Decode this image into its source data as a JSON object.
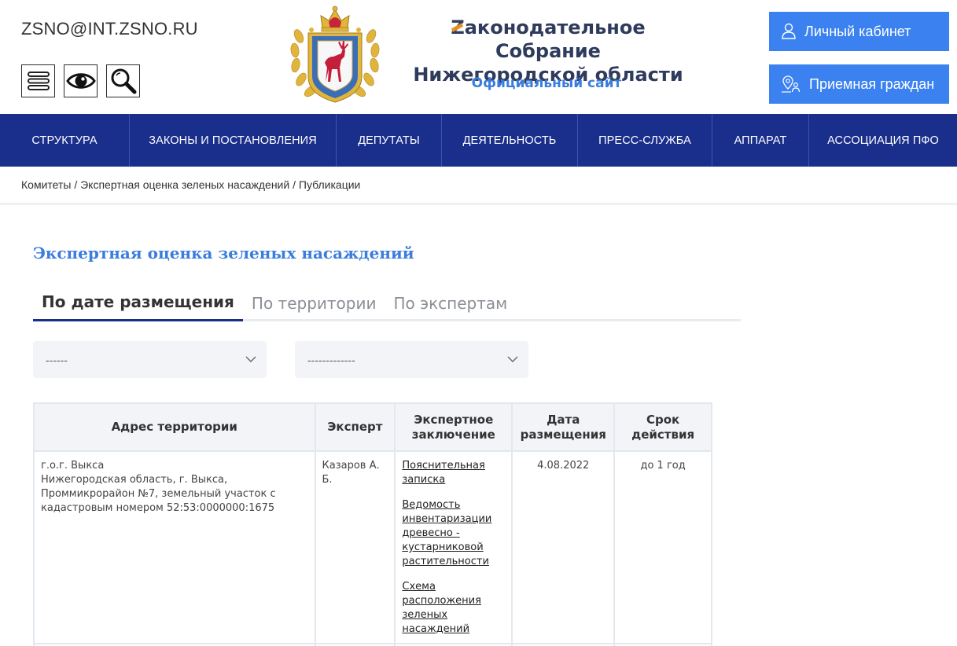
{
  "header": {
    "email": "ZSNO@INT.ZSNO.RU",
    "title_first_letter": "Z",
    "title_line1_rest": "аконодательное Собрание",
    "title_line2": "Нижегородской области",
    "subtitle": "Официальный сайт",
    "cabinet_button": "Личный кабинет",
    "reception_button": "Приемная граждан",
    "tools": [
      "menu-icon",
      "eye-icon",
      "search-icon"
    ]
  },
  "nav": {
    "items": [
      "СТРУКТУРА",
      "ЗАКОНЫ И ПОСТАНОВЛЕНИЯ",
      "ДЕПУТАТЫ",
      "ДЕЯТЕЛЬНОСТЬ",
      "ПРЕСС-СЛУЖБА",
      "АППАРАТ",
      "АССОЦИАЦИЯ ПФО"
    ]
  },
  "breadcrumb": {
    "items": [
      "Комитеты",
      "Экспертная оценка зеленых насаждений",
      "Публикации"
    ],
    "separator": " / "
  },
  "page": {
    "title": "Экспертная оценка зеленых насаждений",
    "tabs": [
      "По дате размещения",
      "По территории",
      "По экспертам"
    ],
    "filters": [
      "------",
      "-------------"
    ]
  },
  "table": {
    "headers": [
      "Адрес территории",
      "Эксперт",
      "Экспертное заключение",
      "Дата размещения",
      "Срок действия"
    ],
    "rows": [
      {
        "address": [
          "г.о.г. Выкса",
          "Нижегородская область, г. Выкса, Проммикрорайон №7, земельный участок с кадастровым номером 52:53:0000000:1675"
        ],
        "expert": "Казаров А. Б.",
        "documents": [
          "Пояснительная записка",
          "Ведомость инвентаризации древесно - кустарниковой растительности",
          "Схема расположения зеленых насаждений"
        ],
        "date": "4.08.2022",
        "term": "до 1 год"
      }
    ]
  },
  "colors": {
    "nav_bg": "#1a2e8c",
    "accent": "#3b7ddd",
    "button_bg": "#3b82f0"
  }
}
